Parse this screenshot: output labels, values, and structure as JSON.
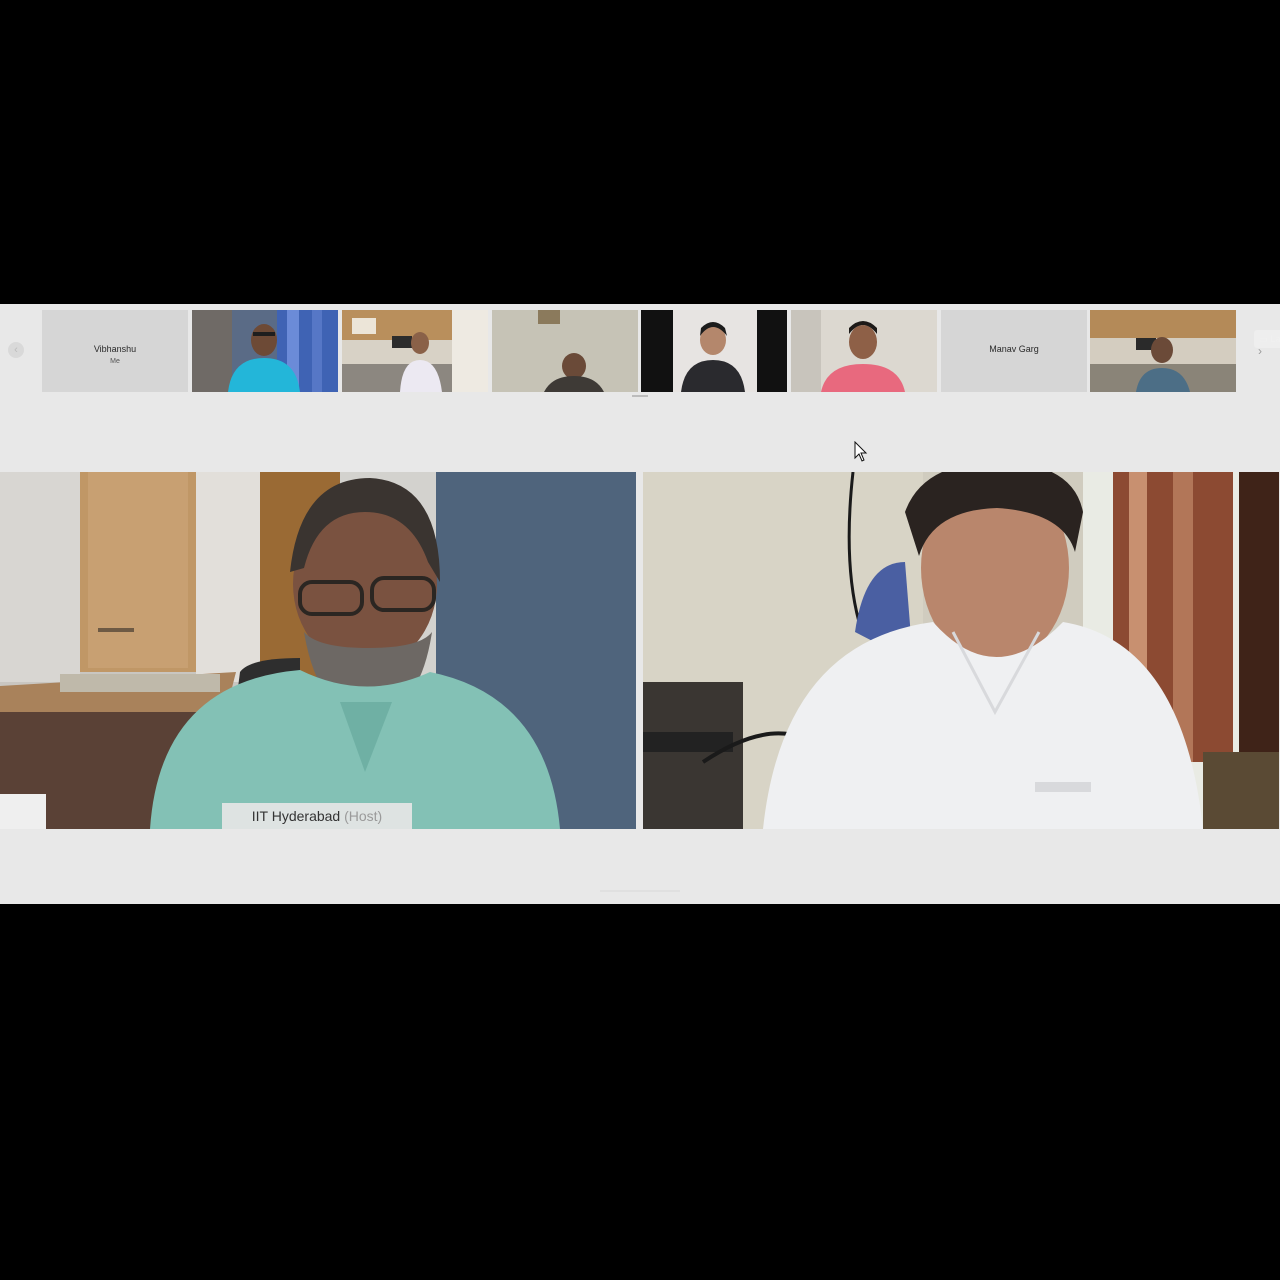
{
  "strip": {
    "tiles": [
      {
        "kind": "name",
        "name": "Vibhanshu",
        "sub": "Me"
      },
      {
        "kind": "video",
        "scene": "man-blue-shirt-curtains"
      },
      {
        "kind": "video",
        "scene": "man-office-room"
      },
      {
        "kind": "video",
        "scene": "man-bald-wall"
      },
      {
        "kind": "video",
        "scene": "woman-dark-background"
      },
      {
        "kind": "video",
        "scene": "man-pink-shirt"
      },
      {
        "kind": "name",
        "name": "Manav Garg",
        "sub": ""
      },
      {
        "kind": "video",
        "scene": "man-office-room-2"
      }
    ],
    "layout_label": "Layout"
  },
  "main": {
    "left": {
      "name": "IIT Hyderabad",
      "role": "(Host)"
    },
    "right": {
      "name": ""
    }
  },
  "colors": {
    "app_bg": "#e8e8e8",
    "frame_bg": "#000000"
  }
}
